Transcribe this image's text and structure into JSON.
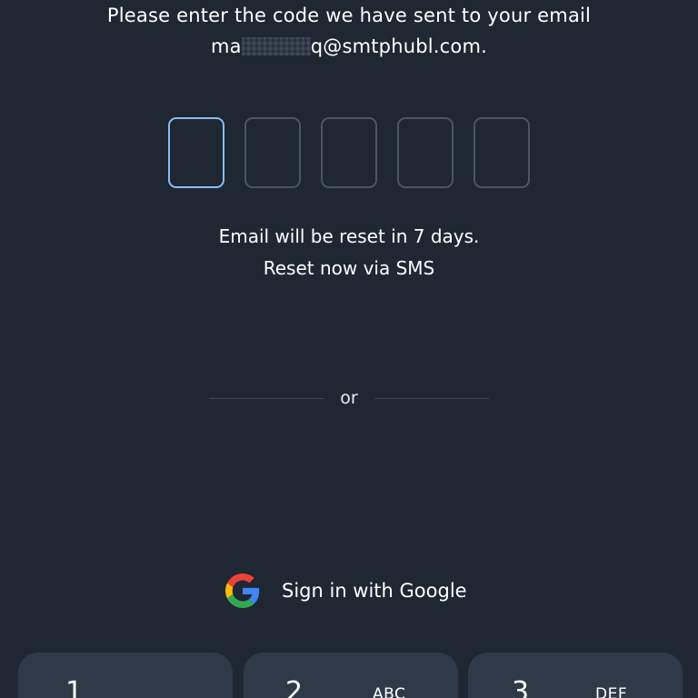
{
  "instruction": {
    "line1": "Please enter the code we have sent to your email",
    "email_prefix": "ma",
    "email_suffix": "q@smtphubl.com."
  },
  "code_boxes": {
    "count": 5,
    "active_index": 0,
    "values": [
      "",
      "",
      "",
      "",
      ""
    ]
  },
  "reset": {
    "line1": "Email will be reset in 7 days.",
    "line2": "Reset now via SMS"
  },
  "divider": {
    "label": "or"
  },
  "google": {
    "label": "Sign in with Google",
    "icon": "google-g-icon"
  },
  "keypad": {
    "keys": [
      {
        "digit": "1",
        "letters": ""
      },
      {
        "digit": "2",
        "letters": "ABC"
      },
      {
        "digit": "3",
        "letters": "DEF"
      }
    ]
  },
  "colors": {
    "background": "#1f2733",
    "box_border": "#4a5565",
    "box_active": "#8cbcf0",
    "key_bg": "#2f3a48"
  }
}
